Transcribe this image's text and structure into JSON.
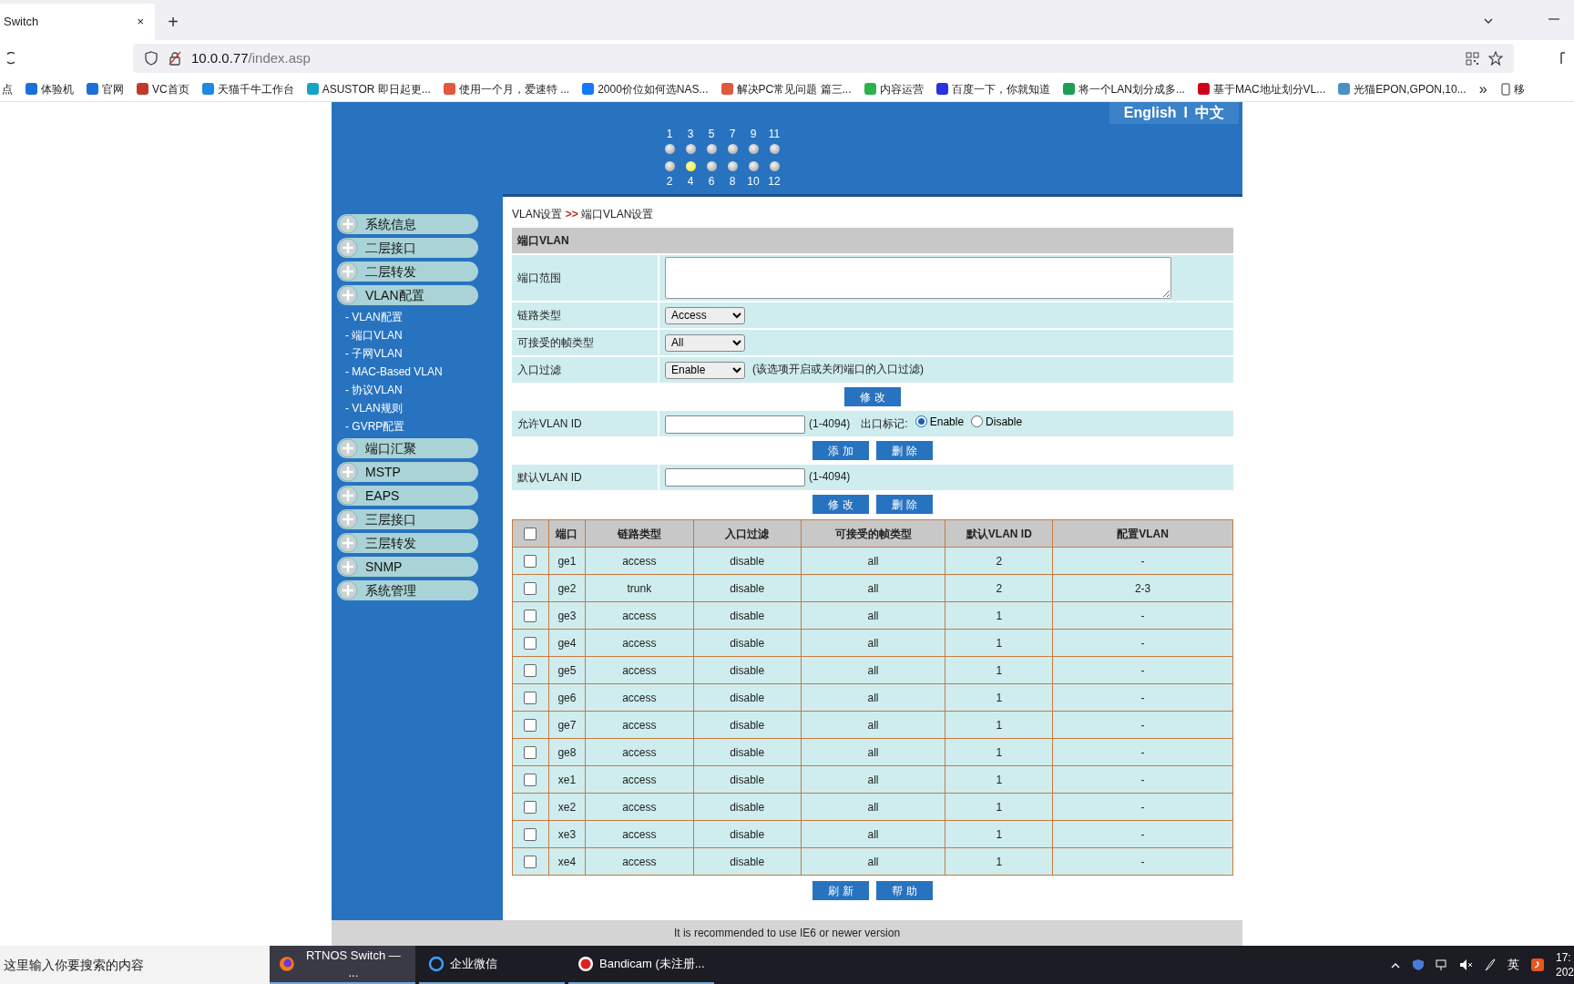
{
  "browser": {
    "tab_title": "Switch",
    "tab_close": "×",
    "new_tab": "+",
    "url_host": "10.0.0.77",
    "url_path": "/index.asp",
    "bookmarks": [
      {
        "label": "点"
      },
      {
        "label": "体验机",
        "color": "#1e6fd9"
      },
      {
        "label": "官网",
        "color": "#1e6fd9"
      },
      {
        "label": "VC首页",
        "color": "#c0392b"
      },
      {
        "label": "天猫千牛工作台",
        "color": "#1e88e5"
      },
      {
        "label": "ASUSTOR 即日起更...",
        "color": "#1aa3c9"
      },
      {
        "label": "使用一个月，爱速特 ...",
        "color": "#e2583e"
      },
      {
        "label": "2000价位如何选NAS...",
        "color": "#1677ff"
      },
      {
        "label": "解决PC常见问题 篇三...",
        "color": "#e2583e"
      },
      {
        "label": "内容运营",
        "color": "#2bb24c"
      },
      {
        "label": "百度一下，你就知道",
        "color": "#2932e1"
      },
      {
        "label": "将一个LAN划分成多...",
        "color": "#1f9d55"
      },
      {
        "label": "基于MAC地址划分VL...",
        "color": "#d0021b"
      },
      {
        "label": "光猫EPON,GPON,10...",
        "color": "#4a90c2"
      }
    ],
    "bookmarks_more": "»",
    "bookmark_cut": "移"
  },
  "header": {
    "languages": [
      "English",
      "中文"
    ],
    "language_separator": "I",
    "ports": [
      {
        "label": "1",
        "on": false
      },
      {
        "label": "2",
        "on": false
      },
      {
        "label": "3",
        "on": false
      },
      {
        "label": "4",
        "on": true
      },
      {
        "label": "5",
        "on": false
      },
      {
        "label": "6",
        "on": false
      },
      {
        "label": "7",
        "on": false
      },
      {
        "label": "8",
        "on": false
      },
      {
        "label": "9",
        "on": false
      },
      {
        "label": "10",
        "on": false
      },
      {
        "label": "11",
        "on": false
      },
      {
        "label": "12",
        "on": false
      }
    ]
  },
  "sidebar": {
    "items": [
      {
        "label": "系统信息"
      },
      {
        "label": "二层接口"
      },
      {
        "label": "二层转发"
      },
      {
        "label": "VLAN配置",
        "children": [
          {
            "label": "- VLAN配置"
          },
          {
            "label": "- 端口VLAN"
          },
          {
            "label": "- 子网VLAN"
          },
          {
            "label": "- MAC-Based VLAN"
          },
          {
            "label": "- 协议VLAN"
          },
          {
            "label": "- VLAN规则"
          },
          {
            "label": "- GVRP配置"
          }
        ]
      },
      {
        "label": "端口汇聚"
      },
      {
        "label": "MSTP"
      },
      {
        "label": "EAPS"
      },
      {
        "label": "三层接口"
      },
      {
        "label": "三层转发"
      },
      {
        "label": "SNMP"
      },
      {
        "label": "系统管理"
      }
    ]
  },
  "breadcrumb": {
    "parent": "VLAN设置",
    "separator": ">>",
    "current": "端口VLAN设置"
  },
  "form": {
    "title": "端口VLAN",
    "rows": [
      {
        "kind": "textarea",
        "label": "端口范围"
      },
      {
        "kind": "select",
        "label": "链路类型",
        "value": "Access"
      },
      {
        "kind": "select",
        "label": "可接受的帧类型",
        "value": "All"
      },
      {
        "kind": "select",
        "label": "入口过滤",
        "value": "Enable",
        "note": "(该选项开启或关闭端口的入口过滤)"
      }
    ],
    "buttons": [
      "修 改"
    ]
  },
  "allowed_vlan": {
    "label": "允许VLAN ID",
    "range": "(1-4094)",
    "tag_label": "出口标记:",
    "options": [
      {
        "label": "Enable",
        "selected": true
      },
      {
        "label": "Disable",
        "selected": false
      }
    ],
    "buttons": [
      "添 加",
      "删 除"
    ]
  },
  "default_vlan": {
    "label": "默认VLAN ID",
    "range": "(1-4094)",
    "buttons": [
      "修 改",
      "删 除"
    ]
  },
  "table": {
    "select_all_checked": false,
    "columns": [
      "端口",
      "链路类型",
      "入口过滤",
      "可接受的帧类型",
      "默认VLAN ID",
      "配置VLAN"
    ],
    "rows": [
      {
        "checked": false,
        "cells": [
          "ge1",
          "access",
          "disable",
          "all",
          "2",
          "-"
        ]
      },
      {
        "checked": false,
        "cells": [
          "ge2",
          "trunk",
          "disable",
          "all",
          "2",
          "2-3"
        ]
      },
      {
        "checked": false,
        "cells": [
          "ge3",
          "access",
          "disable",
          "all",
          "1",
          "-"
        ]
      },
      {
        "checked": false,
        "cells": [
          "ge4",
          "access",
          "disable",
          "all",
          "1",
          "-"
        ]
      },
      {
        "checked": false,
        "cells": [
          "ge5",
          "access",
          "disable",
          "all",
          "1",
          "-"
        ]
      },
      {
        "checked": false,
        "cells": [
          "ge6",
          "access",
          "disable",
          "all",
          "1",
          "-"
        ]
      },
      {
        "checked": false,
        "cells": [
          "ge7",
          "access",
          "disable",
          "all",
          "1",
          "-"
        ]
      },
      {
        "checked": false,
        "cells": [
          "ge8",
          "access",
          "disable",
          "all",
          "1",
          "-"
        ]
      },
      {
        "checked": false,
        "cells": [
          "xe1",
          "access",
          "disable",
          "all",
          "1",
          "-"
        ]
      },
      {
        "checked": false,
        "cells": [
          "xe2",
          "access",
          "disable",
          "all",
          "1",
          "-"
        ]
      },
      {
        "checked": false,
        "cells": [
          "xe3",
          "access",
          "disable",
          "all",
          "1",
          "-"
        ]
      },
      {
        "checked": false,
        "cells": [
          "xe4",
          "access",
          "disable",
          "all",
          "1",
          "-"
        ]
      }
    ],
    "buttons": [
      "刷 新",
      "帮 助"
    ]
  },
  "footer": "It is recommended to use IE6 or newer version",
  "taskbar": {
    "search_placeholder": "这里输入你要搜索的内容",
    "apps": [
      {
        "label": "RTNOS Switch — ...",
        "selected": true
      },
      {
        "label": "企业微信",
        "selected": false
      },
      {
        "label": "Bandicam (未注册...",
        "selected": false
      }
    ],
    "ime": "英",
    "time": "17:",
    "date": "202"
  }
}
